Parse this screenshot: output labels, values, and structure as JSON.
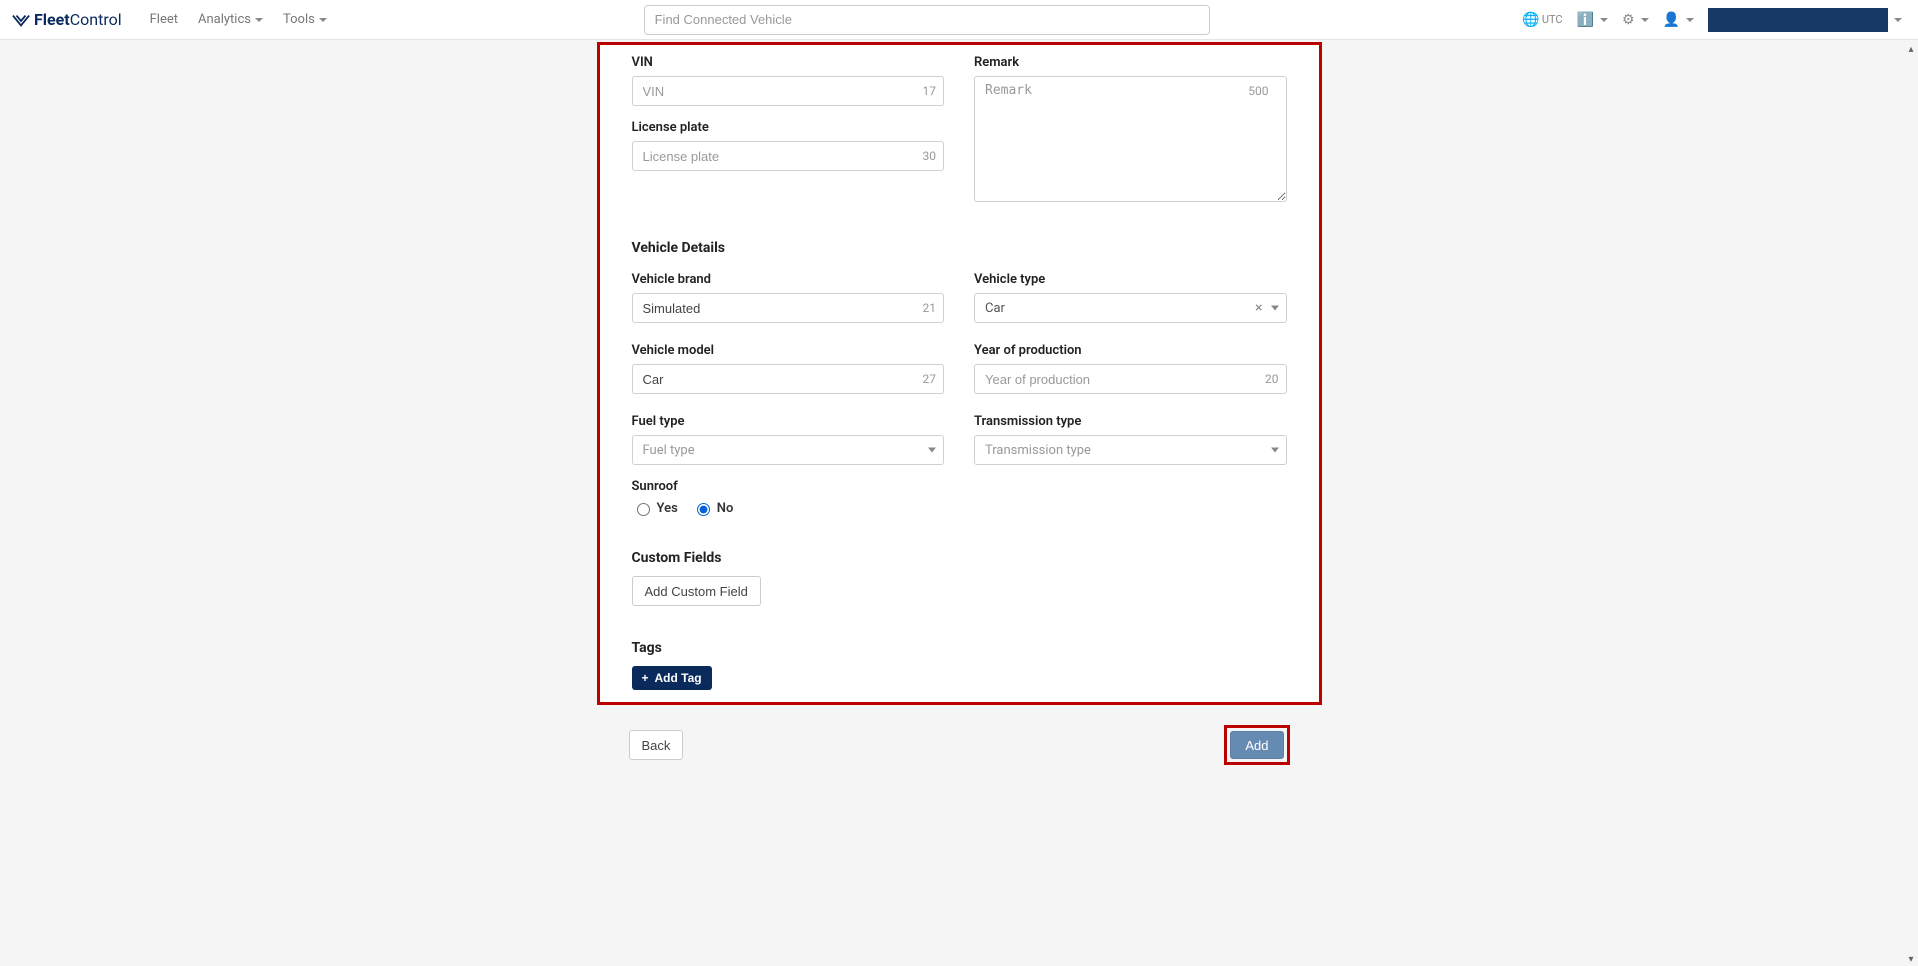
{
  "nav": {
    "brand_strong": "Fleet",
    "brand_light": "Control",
    "items": [
      {
        "label": "Fleet",
        "has_caret": false
      },
      {
        "label": "Analytics",
        "has_caret": true
      },
      {
        "label": "Tools",
        "has_caret": true
      }
    ],
    "search_placeholder": "Find Connected Vehicle",
    "tz_label": "UTC"
  },
  "section_basic": {
    "vin": {
      "label": "VIN",
      "placeholder": "VIN",
      "counter": "17"
    },
    "license": {
      "label": "License plate",
      "placeholder": "License plate",
      "counter": "30"
    },
    "remark": {
      "label": "Remark",
      "placeholder": "Remark",
      "counter": "500"
    }
  },
  "section_details": {
    "title": "Vehicle Details",
    "brand": {
      "label": "Vehicle brand",
      "value": "Simulated",
      "counter": "21"
    },
    "vtype": {
      "label": "Vehicle type",
      "value": "Car",
      "clearable": true
    },
    "model": {
      "label": "Vehicle model",
      "value": "Car",
      "counter": "27"
    },
    "year": {
      "label": "Year of production",
      "placeholder": "Year of production",
      "counter": "20"
    },
    "fuel": {
      "label": "Fuel type",
      "placeholder": "Fuel type"
    },
    "transmission": {
      "label": "Transmission type",
      "placeholder": "Transmission type"
    },
    "sunroof": {
      "label": "Sunroof",
      "yes": "Yes",
      "no": "No",
      "selected": "no"
    }
  },
  "section_custom": {
    "title": "Custom Fields",
    "add_button": "Add Custom Field"
  },
  "section_tags": {
    "title": "Tags",
    "add_button": "Add Tag"
  },
  "footer": {
    "back": "Back",
    "add": "Add"
  }
}
